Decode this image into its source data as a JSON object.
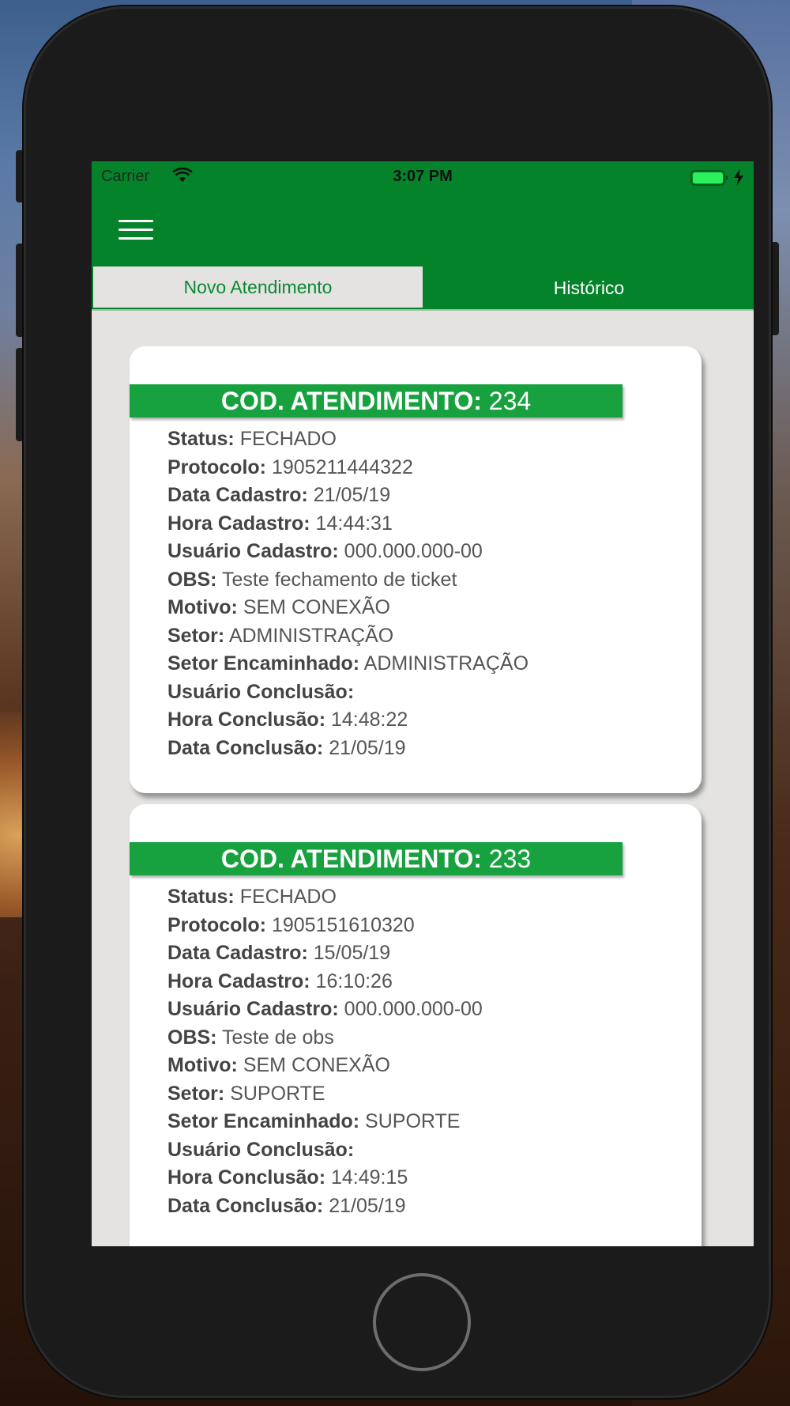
{
  "status_bar": {
    "carrier": "Carrier",
    "time": "3:07 PM",
    "wifi_icon": "wifi-icon",
    "battery_icon": "battery-icon",
    "charging_icon": "lightning-bolt-icon"
  },
  "nav": {
    "menu_icon": "hamburger-menu-icon"
  },
  "tabs": [
    {
      "label": "Novo Atendimento",
      "active": true
    },
    {
      "label": "Histórico",
      "active": false
    }
  ],
  "colors": {
    "primary_green": "#04832a",
    "header_green": "#17a13f",
    "background": "#e4e3e1"
  },
  "cards": [
    {
      "code_label": "COD. ATENDIMENTO:",
      "code_value": "234",
      "fields": [
        {
          "label": "Status:",
          "value": "FECHADO"
        },
        {
          "label": "Protocolo:",
          "value": "1905211444322"
        },
        {
          "label": "Data Cadastro:",
          "value": "21/05/19"
        },
        {
          "label": "Hora Cadastro:",
          "value": "14:44:31"
        },
        {
          "label": "Usuário Cadastro:",
          "value": "000.000.000-00"
        },
        {
          "label": "OBS:",
          "value": "Teste fechamento de ticket"
        },
        {
          "label": "Motivo:",
          "value": "SEM CONEXÃO"
        },
        {
          "label": "Setor:",
          "value": "ADMINISTRAÇÃO"
        },
        {
          "label": "Setor Encaminhado:",
          "value": "ADMINISTRAÇÃO"
        },
        {
          "label": "Usuário Conclusão:",
          "value": ""
        },
        {
          "label": "Hora Conclusão:",
          "value": "14:48:22"
        },
        {
          "label": "Data Conclusão:",
          "value": "21/05/19"
        }
      ]
    },
    {
      "code_label": "COD. ATENDIMENTO:",
      "code_value": "233",
      "fields": [
        {
          "label": "Status:",
          "value": "FECHADO"
        },
        {
          "label": "Protocolo:",
          "value": "1905151610320"
        },
        {
          "label": "Data Cadastro:",
          "value": "15/05/19"
        },
        {
          "label": "Hora Cadastro:",
          "value": "16:10:26"
        },
        {
          "label": "Usuário Cadastro:",
          "value": "000.000.000-00"
        },
        {
          "label": "OBS:",
          "value": "Teste de obs"
        },
        {
          "label": "Motivo:",
          "value": "SEM CONEXÃO"
        },
        {
          "label": "Setor:",
          "value": "SUPORTE"
        },
        {
          "label": "Setor Encaminhado:",
          "value": "SUPORTE"
        },
        {
          "label": "Usuário Conclusão:",
          "value": ""
        },
        {
          "label": "Hora Conclusão:",
          "value": "14:49:15"
        },
        {
          "label": "Data Conclusão:",
          "value": "21/05/19"
        }
      ]
    }
  ]
}
